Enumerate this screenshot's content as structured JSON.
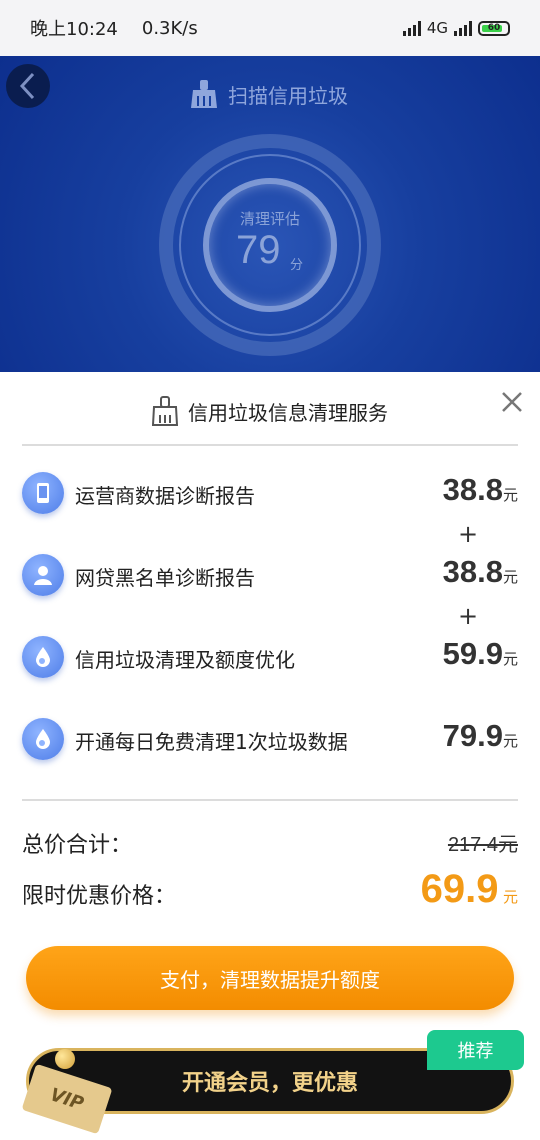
{
  "status_bar": {
    "time": "晚上10:24",
    "speed": "0.3K/s",
    "network": "4G",
    "battery": "60"
  },
  "header": {
    "title": "扫描信用垃圾",
    "score_label": "清理评估",
    "score_value": "79",
    "score_unit": "分"
  },
  "panel": {
    "title": "信用垃圾信息清理服务",
    "items": [
      {
        "name": "运营商数据诊断报告",
        "price": "38.8",
        "unit": "元",
        "icon": "phone-icon"
      },
      {
        "name": "网贷黑名单诊断报告",
        "price": "38.8",
        "unit": "元",
        "icon": "user-icon"
      },
      {
        "name": "信用垃圾清理及额度优化",
        "price": "59.9",
        "unit": "元",
        "icon": "drop-icon"
      },
      {
        "name": "开通每日免费清理1次垃圾数据",
        "price": "79.9",
        "unit": "元",
        "icon": "drop-icon"
      }
    ],
    "plus": "+",
    "total_label": "总价合计：",
    "total_value": "217.4元",
    "promo_label": "限时优惠价格：",
    "promo_value": "69.9",
    "promo_unit": "元"
  },
  "actions": {
    "pay_label": "支付，清理数据提升额度",
    "vip_label": "开通会员，更优惠",
    "vip_badge": "VIP",
    "recommend_label": "推荐"
  },
  "colors": {
    "header_blue": "#173f9f",
    "accent_orange": "#f39a16",
    "recommend_green": "#1dc98f",
    "vip_gold": "#d9b45e"
  }
}
